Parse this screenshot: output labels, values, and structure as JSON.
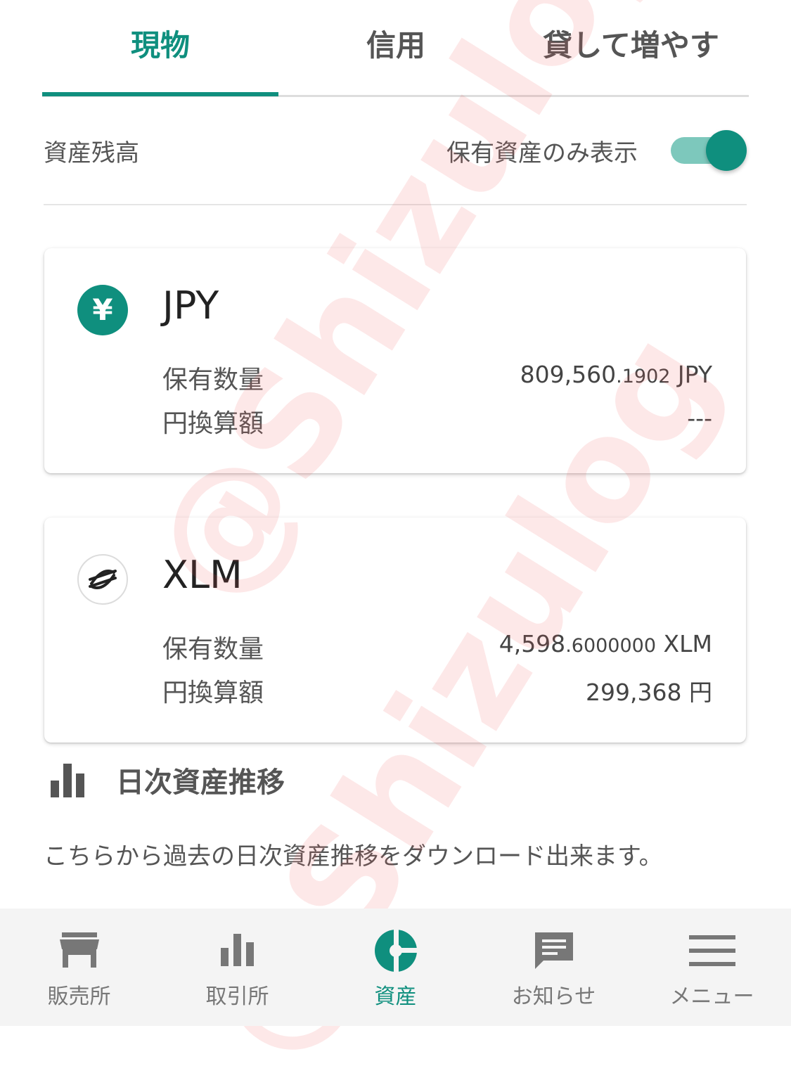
{
  "tabs": [
    {
      "label": "現物",
      "active": true
    },
    {
      "label": "信用",
      "active": false
    },
    {
      "label": "貸して増やす",
      "active": false
    }
  ],
  "header": {
    "balance_label": "資産残高",
    "toggle_label": "保有資産のみ表示",
    "toggle_on": true
  },
  "assets": [
    {
      "icon": "yen-icon",
      "icon_text": "¥",
      "name": "JPY",
      "qty_label": "保有数量",
      "qty_main": "809,560",
      "qty_decimal": ".1902",
      "qty_unit": " JPY",
      "jpy_label": "円換算額",
      "jpy_value": "---"
    },
    {
      "icon": "stellar-icon",
      "name": "XLM",
      "qty_label": "保有数量",
      "qty_main": "4,598",
      "qty_decimal": ".6000000",
      "qty_unit": " XLM",
      "jpy_label": "円換算額",
      "jpy_value": "299,368 円"
    }
  ],
  "daily": {
    "title": "日次資産推移",
    "description": "こちらから過去の日次資産推移をダウンロード出来ます。"
  },
  "bottom_nav": [
    {
      "label": "販売所",
      "icon": "store-icon",
      "active": false
    },
    {
      "label": "取引所",
      "icon": "bar-chart-icon",
      "active": false
    },
    {
      "label": "資産",
      "icon": "pie-chart-icon",
      "active": true
    },
    {
      "label": "お知らせ",
      "icon": "message-icon",
      "active": false
    },
    {
      "label": "メニュー",
      "icon": "menu-icon",
      "active": false
    }
  ],
  "watermark": "@Shizulog",
  "colors": {
    "accent": "#0f8f7e",
    "text": "#555555",
    "watermark": "#f05050"
  }
}
